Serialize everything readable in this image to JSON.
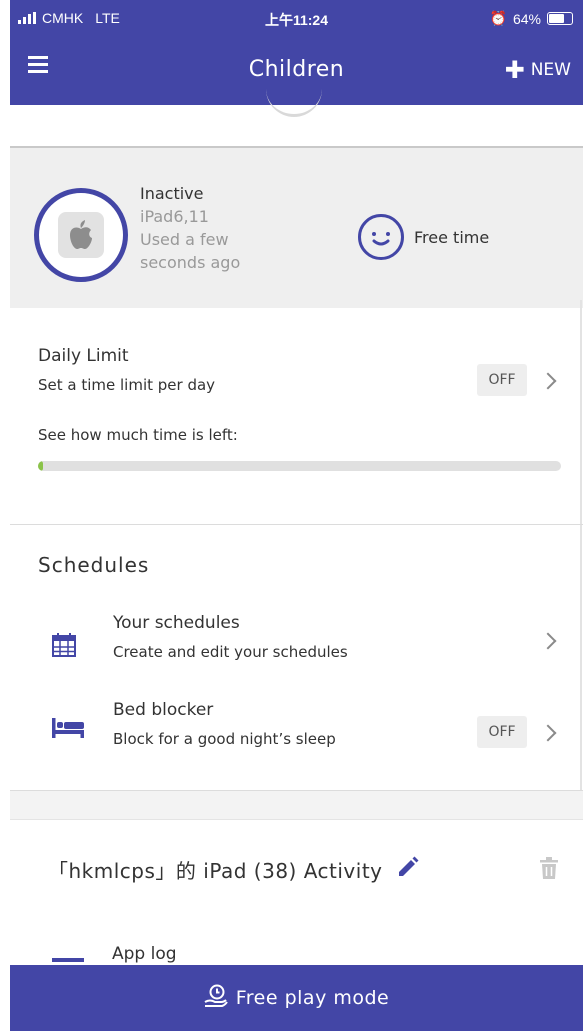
{
  "status_bar": {
    "carrier": "CMHK",
    "network": "LTE",
    "time": "上午11:24",
    "battery": "64%"
  },
  "navbar": {
    "title": "Children",
    "new_label": "NEW"
  },
  "device": {
    "status": "Inactive",
    "model": "iPad6,11",
    "last_used_line1": "Used a few",
    "last_used_line2": "seconds ago",
    "mode": "Free time"
  },
  "daily_limit": {
    "title": "Daily Limit",
    "subtitle": "Set a time limit per day",
    "toggle": "OFF",
    "time_left_label": "See how much time is left:",
    "progress_fraction": 0.01
  },
  "schedules": {
    "heading": "Schedules",
    "items": [
      {
        "title": "Your schedules",
        "subtitle": "Create and edit your schedules"
      },
      {
        "title": "Bed blocker",
        "subtitle": "Block for a good night’s sleep",
        "toggle": "OFF"
      }
    ]
  },
  "activity": {
    "title": "「hkmlcps」的 iPad (38) Activity",
    "app_log": "App log"
  },
  "bottom_bar": {
    "label": "Free play mode"
  },
  "colors": {
    "brand": "#4346a6",
    "progress": "#8bc34a"
  }
}
